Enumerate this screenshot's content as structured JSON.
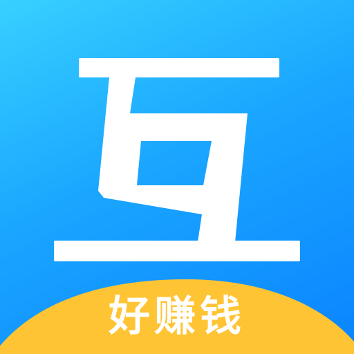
{
  "brand": {
    "logo_glyph": "互",
    "tagline": "好赚钱"
  },
  "colors": {
    "background_top": "#38d0ff",
    "background_bottom": "#0a84ff",
    "glyph": "#ffffff",
    "badge": "#ffc433",
    "badge_text": "#ffffff"
  },
  "icons": {
    "logo": "hu-glyph-logo-icon"
  }
}
